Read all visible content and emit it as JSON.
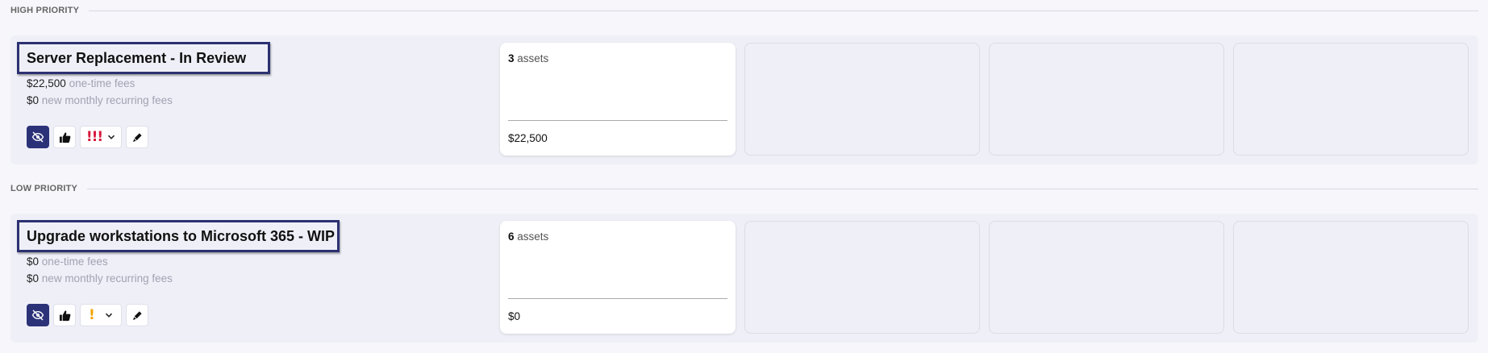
{
  "sections": [
    {
      "label": "HIGH PRIORITY",
      "project": {
        "title": "Server Replacement - In Review",
        "one_time_amount": "$22,500",
        "one_time_label": "one-time fees",
        "monthly_amount": "$0",
        "monthly_label": "new monthly recurring fees",
        "priority_marks": "!!!",
        "priority_color": "#d81b3c",
        "asset_count": "3",
        "asset_label": "assets",
        "asset_total": "$22,500"
      }
    },
    {
      "label": "LOW PRIORITY",
      "project": {
        "title": "Upgrade workstations to Microsoft 365 - WIP",
        "one_time_amount": "$0",
        "one_time_label": "one-time fees",
        "monthly_amount": "$0",
        "monthly_label": "new monthly recurring fees",
        "priority_marks": "!",
        "priority_color": "#f4a300",
        "asset_count": "6",
        "asset_label": "assets",
        "asset_total": "$0"
      }
    }
  ],
  "icons": {
    "hide": "eye-slash-icon",
    "approve": "thumbs-up-icon",
    "priority_menu": "chevron-down-icon",
    "edit": "pencil-icon"
  },
  "colors": {
    "accent": "#2c3278",
    "card_bg": "#efeff8",
    "page_bg": "#f6f6fb"
  }
}
